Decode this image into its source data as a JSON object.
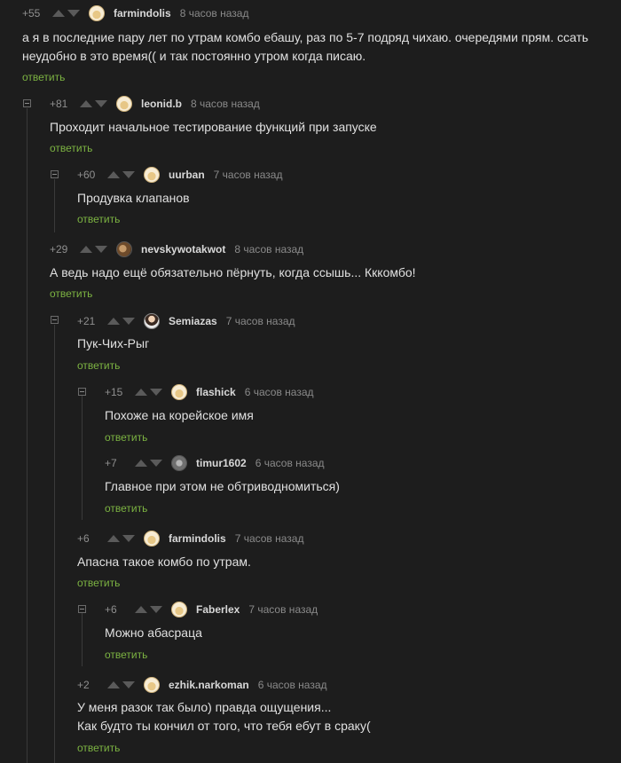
{
  "reply_label": "ответить",
  "comments": [
    {
      "rating": "+55",
      "user": "farmindolis",
      "time": "8 часов назад",
      "text": "а я в последние пару лет по утрам комбо ебашу, раз по 5-7 подряд чихаю. очередями прям. ссать неудобно в это время(( и так постоянно утром когда писаю."
    },
    {
      "rating": "+81",
      "user": "leonid.b",
      "time": "8 часов назад",
      "text": "Проходит начальное тестирование функций при запуске"
    },
    {
      "rating": "+60",
      "user": "uurban",
      "time": "7 часов назад",
      "text": "Продувка клапанов"
    },
    {
      "rating": "+29",
      "user": "nevskywotakwot",
      "time": "8 часов назад",
      "text": "А ведь надо ещё обязательно пёрнуть, когда ссышь... Кккомбо!"
    },
    {
      "rating": "+21",
      "user": "Semiazas",
      "time": "7 часов назад",
      "text": "Пук-Чих-Рыг"
    },
    {
      "rating": "+15",
      "user": "flashick",
      "time": "6 часов назад",
      "text": "Похоже на корейское имя"
    },
    {
      "rating": "+7",
      "user": "timur1602",
      "time": "6 часов назад",
      "text": "Главное при этом не обтриводномиться)"
    },
    {
      "rating": "+6",
      "user": "farmindolis",
      "time": "7 часов назад",
      "text": "Апасна такое комбо по утрам."
    },
    {
      "rating": "+6",
      "user": "Faberlex",
      "time": "7 часов назад",
      "text": "Можно абасраца"
    },
    {
      "rating": "+2",
      "user": "ezhik.narkoman",
      "time": "6 часов назад",
      "text": "У меня разок так было) правда ощущения...\nКак будто ты кончил от того, что тебя ебут в сраку("
    }
  ]
}
